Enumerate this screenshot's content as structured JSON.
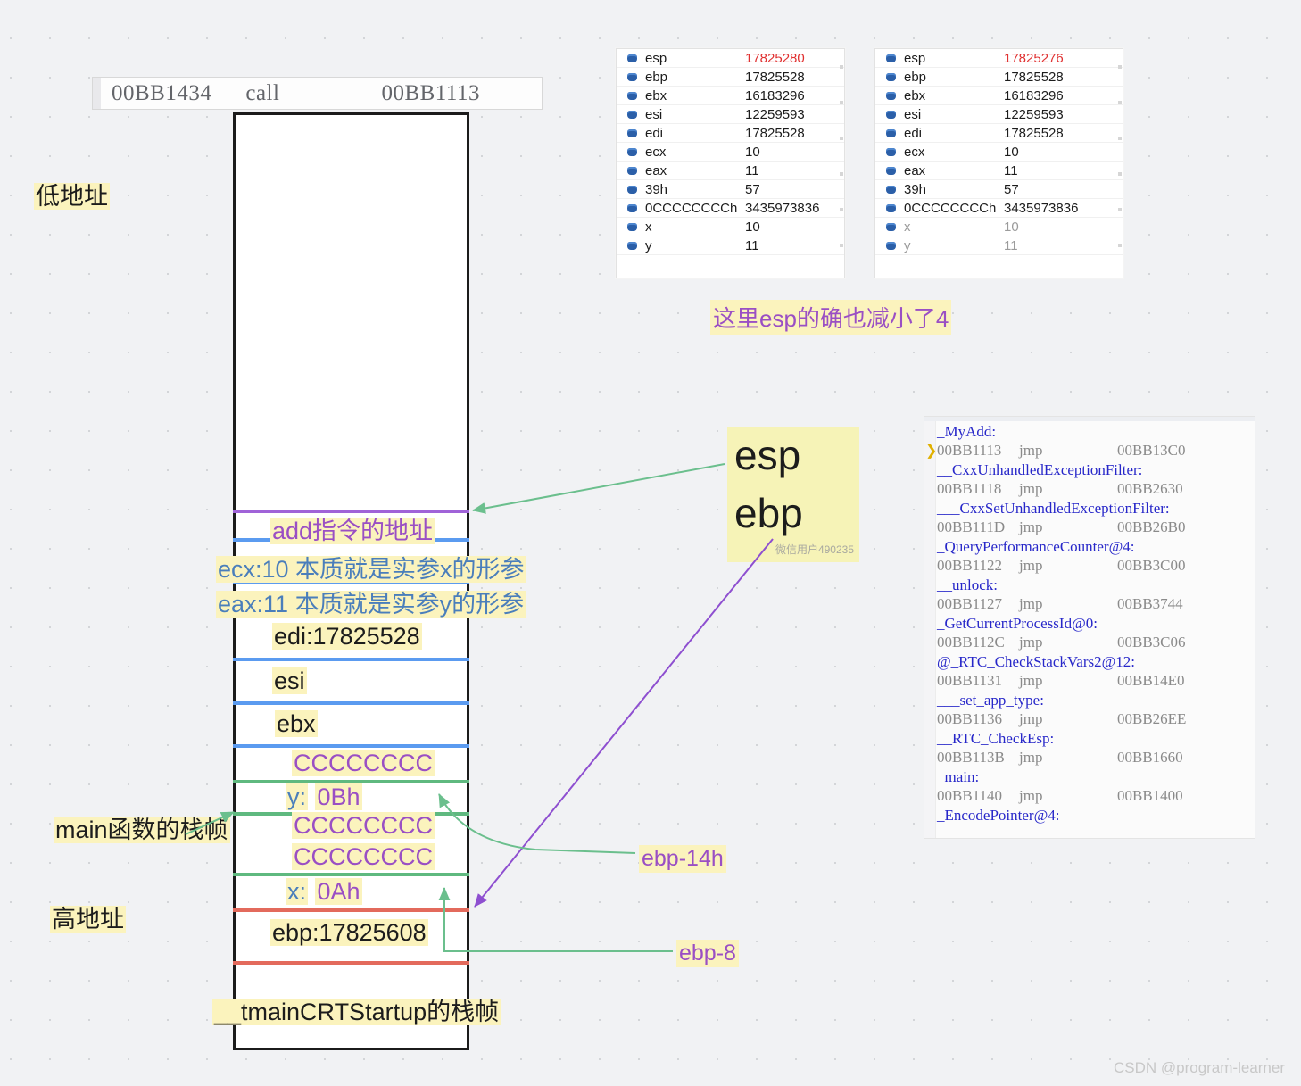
{
  "code_line": {
    "address": "00BB1434",
    "mnemonic": "call",
    "target": "00BB1113"
  },
  "side_labels": {
    "low_address": "低地址",
    "high_address": "高地址",
    "main_frame": "main函数的栈帧",
    "crt_frame": "__tmainCRTStartup的栈帧"
  },
  "stack_cells": {
    "add_addr": "add指令的地址",
    "ecx_param": "ecx:10  本质就是实参x的形参",
    "eax_param": "eax:11  本质就是实参y的形参",
    "edi": "edi:17825528",
    "esi": "esi",
    "ebx": "ebx",
    "cc1": "CCCCCCCC",
    "y_label": "y:",
    "y_value": "0Bh",
    "cc2": "CCCCCCCC",
    "cc3": "CCCCCCCC",
    "x_label": "x:",
    "x_value": "0Ah",
    "ebp": "ebp:17825608"
  },
  "callouts": {
    "esp_note": "esp",
    "ebp_note": "ebp",
    "note_watermark": "微信用户490235",
    "esp_decrease": "这里esp的确也减小了4",
    "ebp_minus_14h": "ebp-14h",
    "ebp_minus_8": "ebp-8"
  },
  "watch_left": {
    "rows": [
      {
        "name": "esp",
        "value": "17825280",
        "highlight": true,
        "dim": false
      },
      {
        "name": "ebp",
        "value": "17825528",
        "highlight": false,
        "dim": false
      },
      {
        "name": "ebx",
        "value": "16183296",
        "highlight": false,
        "dim": false
      },
      {
        "name": "esi",
        "value": "12259593",
        "highlight": false,
        "dim": false
      },
      {
        "name": "edi",
        "value": "17825528",
        "highlight": false,
        "dim": false
      },
      {
        "name": "ecx",
        "value": "10",
        "highlight": false,
        "dim": false
      },
      {
        "name": "eax",
        "value": "11",
        "highlight": false,
        "dim": false
      },
      {
        "name": "39h",
        "value": "57",
        "highlight": false,
        "dim": false
      },
      {
        "name": "0CCCCCCCCh",
        "value": "3435973836",
        "highlight": false,
        "dim": false
      },
      {
        "name": "x",
        "value": "10",
        "highlight": false,
        "dim": false
      },
      {
        "name": "y",
        "value": "11",
        "highlight": false,
        "dim": false
      }
    ]
  },
  "watch_right": {
    "rows": [
      {
        "name": "esp",
        "value": "17825276",
        "highlight": true,
        "dim": false
      },
      {
        "name": "ebp",
        "value": "17825528",
        "highlight": false,
        "dim": false
      },
      {
        "name": "ebx",
        "value": "16183296",
        "highlight": false,
        "dim": false
      },
      {
        "name": "esi",
        "value": "12259593",
        "highlight": false,
        "dim": false
      },
      {
        "name": "edi",
        "value": "17825528",
        "highlight": false,
        "dim": false
      },
      {
        "name": "ecx",
        "value": "10",
        "highlight": false,
        "dim": false
      },
      {
        "name": "eax",
        "value": "11",
        "highlight": false,
        "dim": false
      },
      {
        "name": "39h",
        "value": "57",
        "highlight": false,
        "dim": false
      },
      {
        "name": "0CCCCCCCCh",
        "value": "3435973836",
        "highlight": false,
        "dim": false
      },
      {
        "name": "x",
        "value": "10",
        "highlight": false,
        "dim": true
      },
      {
        "name": "y",
        "value": "11",
        "highlight": false,
        "dim": true
      }
    ]
  },
  "disassembly": {
    "lines": [
      {
        "type": "label",
        "text": "_MyAdd:",
        "marker": false
      },
      {
        "type": "code",
        "address": "00BB1113",
        "op": "jmp",
        "target": "00BB13C0",
        "marker": true
      },
      {
        "type": "label",
        "text": "__CxxUnhandledExceptionFilter:",
        "marker": false
      },
      {
        "type": "code",
        "address": "00BB1118",
        "op": "jmp",
        "target": "00BB2630",
        "marker": false
      },
      {
        "type": "label",
        "text": "___CxxSetUnhandledExceptionFilter:",
        "marker": false
      },
      {
        "type": "code",
        "address": "00BB111D",
        "op": "jmp",
        "target": "00BB26B0",
        "marker": false
      },
      {
        "type": "label",
        "text": "_QueryPerformanceCounter@4:",
        "marker": false
      },
      {
        "type": "code",
        "address": "00BB1122",
        "op": "jmp",
        "target": "00BB3C00",
        "marker": false
      },
      {
        "type": "label",
        "text": "__unlock:",
        "marker": false
      },
      {
        "type": "code",
        "address": "00BB1127",
        "op": "jmp",
        "target": "00BB3744",
        "marker": false
      },
      {
        "type": "label",
        "text": "_GetCurrentProcessId@0:",
        "marker": false
      },
      {
        "type": "code",
        "address": "00BB112C",
        "op": "jmp",
        "target": "00BB3C06",
        "marker": false
      },
      {
        "type": "label",
        "text": "@_RTC_CheckStackVars2@12:",
        "marker": false
      },
      {
        "type": "code",
        "address": "00BB1131",
        "op": "jmp",
        "target": "00BB14E0",
        "marker": false
      },
      {
        "type": "label",
        "text": "___set_app_type:",
        "marker": false
      },
      {
        "type": "code",
        "address": "00BB1136",
        "op": "jmp",
        "target": "00BB26EE",
        "marker": false
      },
      {
        "type": "label",
        "text": "__RTC_CheckEsp:",
        "marker": false
      },
      {
        "type": "code",
        "address": "00BB113B",
        "op": "jmp",
        "target": "00BB1660",
        "marker": false
      },
      {
        "type": "label",
        "text": "_main:",
        "marker": false
      },
      {
        "type": "code",
        "address": "00BB1140",
        "op": "jmp",
        "target": "00BB1400",
        "marker": false
      },
      {
        "type": "label",
        "text": "_EncodePointer@4:",
        "marker": false
      }
    ]
  },
  "footer": {
    "watermark": "CSDN @program-learner"
  },
  "colors": {
    "purple_line": "#a063d8",
    "blue_line": "#5b9bf0",
    "green_line": "#5fb97f",
    "red_line": "#e36a5c",
    "highlight": "#fbf3bd",
    "note": "#f6f3b7",
    "accent_red": "#e03131"
  }
}
